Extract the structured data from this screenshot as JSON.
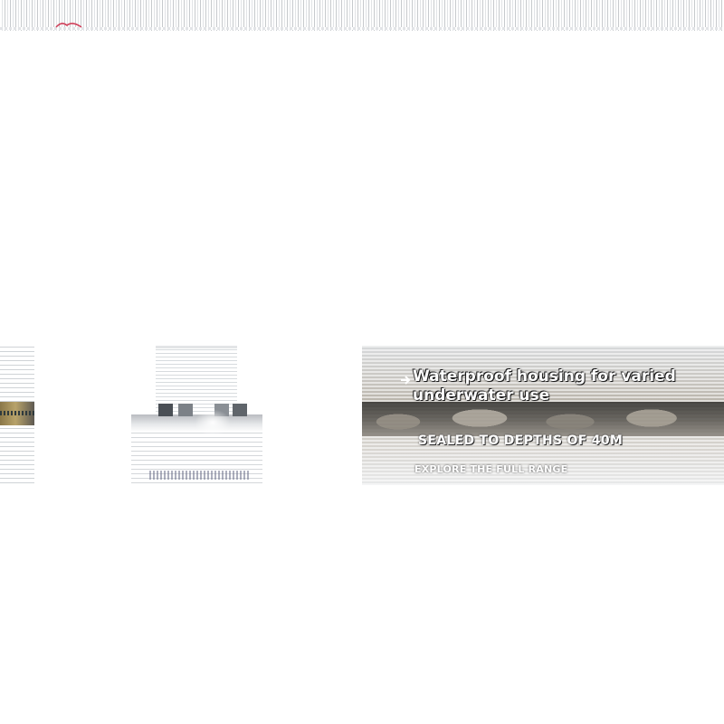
{
  "banner": {
    "headline_line1": "Waterproof housing for varied",
    "headline_line2": "underwater use",
    "subline": "SEALED TO DEPTHS OF 40M",
    "smallline": "EXPLORE THE FULL RANGE"
  },
  "icons": {
    "brand": "brand-logo-icon",
    "arrow": "arrow-right-icon"
  },
  "colors": {
    "logo": "#d0405a",
    "overlay_text": "#ffffff"
  }
}
